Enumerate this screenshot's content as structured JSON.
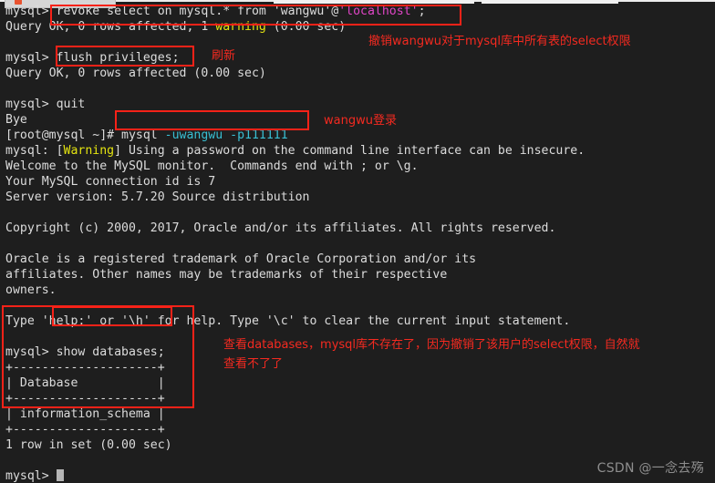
{
  "window": {
    "background_color": "#1e1e1e",
    "foreground_color": "#d8d8d8",
    "annotation_color": "#f42a20",
    "tab_bar_color": "#ececec"
  },
  "terminal": {
    "lines": [
      {
        "id": "l01",
        "segments": [
          {
            "t": "mysql> ",
            "c": "white"
          },
          {
            "t": "revoke select on mysql.* from 'wangwu'@",
            "c": "white"
          },
          {
            "t": "'localhost'",
            "c": "magenta"
          },
          {
            "t": ";",
            "c": "white"
          }
        ]
      },
      {
        "id": "l02",
        "segments": [
          {
            "t": "Query OK, 0 rows affected, 1 ",
            "c": "white"
          },
          {
            "t": "warning",
            "c": "yellow"
          },
          {
            "t": " (0.00 sec)",
            "c": "white"
          }
        ]
      },
      {
        "id": "l03",
        "segments": [
          {
            "t": "",
            "c": "white"
          }
        ]
      },
      {
        "id": "l04",
        "segments": [
          {
            "t": "mysql> flush privileges;",
            "c": "white"
          }
        ]
      },
      {
        "id": "l05",
        "segments": [
          {
            "t": "Query OK, 0 rows affected (0.00 sec)",
            "c": "white"
          }
        ]
      },
      {
        "id": "l06",
        "segments": [
          {
            "t": "",
            "c": "white"
          }
        ]
      },
      {
        "id": "l07",
        "segments": [
          {
            "t": "mysql> quit",
            "c": "white"
          }
        ]
      },
      {
        "id": "l08",
        "segments": [
          {
            "t": "Bye",
            "c": "white"
          }
        ]
      },
      {
        "id": "l09",
        "segments": [
          {
            "t": "[root@mysql ~]# mysql ",
            "c": "white"
          },
          {
            "t": "-uwangwu -p111111",
            "c": "cyan"
          }
        ]
      },
      {
        "id": "l10",
        "segments": [
          {
            "t": "mysql: [",
            "c": "white"
          },
          {
            "t": "Warning",
            "c": "yellow"
          },
          {
            "t": "] Using a password on the command line interface can be insecure.",
            "c": "white"
          }
        ]
      },
      {
        "id": "l11",
        "segments": [
          {
            "t": "Welcome to the MySQL monitor.  Commands end with ; or \\g.",
            "c": "white"
          }
        ]
      },
      {
        "id": "l12",
        "segments": [
          {
            "t": "Your MySQL connection id is 7",
            "c": "white"
          }
        ]
      },
      {
        "id": "l13",
        "segments": [
          {
            "t": "Server version: 5.7.20 Source distribution",
            "c": "white"
          }
        ]
      },
      {
        "id": "l14",
        "segments": [
          {
            "t": "",
            "c": "white"
          }
        ]
      },
      {
        "id": "l15",
        "segments": [
          {
            "t": "Copyright (c) 2000, 2017, Oracle and/or its affiliates. All rights reserved.",
            "c": "white"
          }
        ]
      },
      {
        "id": "l16",
        "segments": [
          {
            "t": "",
            "c": "white"
          }
        ]
      },
      {
        "id": "l17",
        "segments": [
          {
            "t": "Oracle is a registered trademark of Oracle Corporation and/or its",
            "c": "white"
          }
        ]
      },
      {
        "id": "l18",
        "segments": [
          {
            "t": "affiliates. Other names may be trademarks of their respective",
            "c": "white"
          }
        ]
      },
      {
        "id": "l19",
        "segments": [
          {
            "t": "owners.",
            "c": "white"
          }
        ]
      },
      {
        "id": "l20",
        "segments": [
          {
            "t": "",
            "c": "white"
          }
        ]
      },
      {
        "id": "l21",
        "segments": [
          {
            "t": "Type 'help;' or '\\h' for help. Type '\\c' to clear the current input statement.",
            "c": "white"
          }
        ]
      },
      {
        "id": "l22",
        "segments": [
          {
            "t": "",
            "c": "white"
          }
        ]
      },
      {
        "id": "l23",
        "segments": [
          {
            "t": "mysql> show databases;",
            "c": "white"
          }
        ]
      },
      {
        "id": "l24",
        "segments": [
          {
            "t": "+--------------------+",
            "c": "white"
          }
        ]
      },
      {
        "id": "l25",
        "segments": [
          {
            "t": "| Database           |",
            "c": "white"
          }
        ]
      },
      {
        "id": "l26",
        "segments": [
          {
            "t": "+--------------------+",
            "c": "white"
          }
        ]
      },
      {
        "id": "l27",
        "segments": [
          {
            "t": "| information_schema |",
            "c": "white"
          }
        ]
      },
      {
        "id": "l28",
        "segments": [
          {
            "t": "+--------------------+",
            "c": "white"
          }
        ]
      },
      {
        "id": "l29",
        "segments": [
          {
            "t": "1 row in set (0.00 sec)",
            "c": "white"
          }
        ]
      },
      {
        "id": "l30",
        "segments": [
          {
            "t": "",
            "c": "white"
          }
        ]
      },
      {
        "id": "l31",
        "segments": [
          {
            "t": "mysql> ",
            "c": "white"
          },
          {
            "t": "█",
            "c": "cursor"
          }
        ]
      }
    ],
    "prompt": "mysql>",
    "shell_prompt": "[root@mysql ~]#"
  },
  "highlight_boxes": [
    {
      "id": "box-revoke",
      "target": "revoke select on mysql.* from 'wangwu'@'localhost';"
    },
    {
      "id": "box-flush",
      "target": "flush privileges;"
    },
    {
      "id": "box-login",
      "target": "mysql -uwangwu -p111111"
    },
    {
      "id": "box-show-databases",
      "target": "show databases;"
    },
    {
      "id": "box-result-table",
      "target": "show databases output table"
    }
  ],
  "annotations": [
    {
      "id": "note-revoke",
      "text": "撤销wangwu对于mysql库中所有表的select权限"
    },
    {
      "id": "note-flush",
      "text": "刷新"
    },
    {
      "id": "note-login",
      "text": "wangwu登录"
    },
    {
      "id": "note-result-line1",
      "text": "查看databases，mysql库不存在了，因为撤销了该用户的select权限，自然就"
    },
    {
      "id": "note-result-line2",
      "text": "查看不了了"
    }
  ],
  "watermark": {
    "text": "CSDN @一念去殇"
  }
}
